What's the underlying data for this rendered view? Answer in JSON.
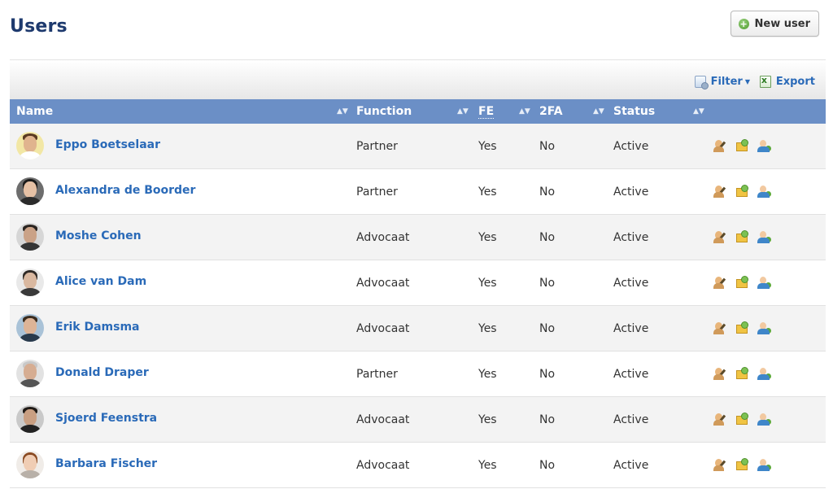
{
  "page": {
    "title": "Users",
    "new_user_label": "New user"
  },
  "toolbar": {
    "filter_label": "Filter",
    "export_label": "Export"
  },
  "columns": {
    "name": "Name",
    "function": "Function",
    "fe": "FE",
    "twofa": "2FA",
    "status": "Status"
  },
  "icons": {
    "new_user": "plus-circle-icon",
    "filter": "filter-icon",
    "export": "excel-icon",
    "sort": "sort-arrows-icon",
    "row_actions": [
      "edit-user-icon",
      "package-icon",
      "user-switch-icon"
    ]
  },
  "colors": {
    "header": "#6b8fc6",
    "link": "#2a6ab8",
    "title": "#1e3a6e"
  },
  "users": [
    {
      "name": "Eppo Boetselaar",
      "function": "Partner",
      "fe": "Yes",
      "twofa": "No",
      "status": "Active"
    },
    {
      "name": "Alexandra de Boorder",
      "function": "Partner",
      "fe": "Yes",
      "twofa": "No",
      "status": "Active"
    },
    {
      "name": "Moshe Cohen",
      "function": "Advocaat",
      "fe": "Yes",
      "twofa": "No",
      "status": "Active"
    },
    {
      "name": "Alice van Dam",
      "function": "Advocaat",
      "fe": "Yes",
      "twofa": "No",
      "status": "Active"
    },
    {
      "name": "Erik Damsma",
      "function": "Advocaat",
      "fe": "Yes",
      "twofa": "No",
      "status": "Active"
    },
    {
      "name": "Donald Draper",
      "function": "Partner",
      "fe": "Yes",
      "twofa": "No",
      "status": "Active"
    },
    {
      "name": "Sjoerd Feenstra",
      "function": "Advocaat",
      "fe": "Yes",
      "twofa": "No",
      "status": "Active"
    },
    {
      "name": "Barbara Fischer",
      "function": "Advocaat",
      "fe": "Yes",
      "twofa": "No",
      "status": "Active"
    }
  ]
}
